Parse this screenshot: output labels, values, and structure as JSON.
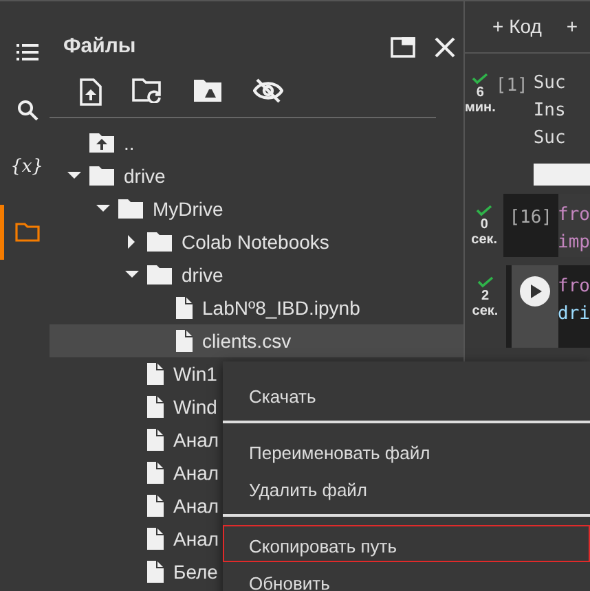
{
  "rail": [
    {
      "kind": "menu",
      "selected": false
    },
    {
      "kind": "search",
      "selected": false
    },
    {
      "kind": "variables",
      "label": "{x}",
      "selected": false
    },
    {
      "kind": "files",
      "selected": true
    }
  ],
  "panel": {
    "title": "Файлы",
    "toolbar": [
      {
        "kind": "upload"
      },
      {
        "kind": "folder-refresh"
      },
      {
        "kind": "drive"
      },
      {
        "kind": "hidden"
      }
    ]
  },
  "tree": [
    {
      "kind": "up",
      "name": ".."
    },
    {
      "kind": "folder",
      "name": "drive",
      "expanded": true,
      "children": [
        {
          "kind": "folder",
          "name": "MyDrive",
          "expanded": true,
          "children": [
            {
              "kind": "folder",
              "name": "Colab Notebooks",
              "expanded": false
            },
            {
              "kind": "folder",
              "name": "drive",
              "expanded": true,
              "children": [
                {
                  "kind": "file",
                  "name": "LabNº8_IBD.ipynb",
                  "selected": false
                },
                {
                  "kind": "file",
                  "name": "clients.csv",
                  "selected": true
                }
              ]
            },
            {
              "kind": "file",
              "name": "Win1",
              "selected": false
            },
            {
              "kind": "file",
              "name": "Wind",
              "selected": false
            },
            {
              "kind": "file",
              "name": "Анал",
              "selected": false
            },
            {
              "kind": "file",
              "name": "Анал",
              "selected": false
            },
            {
              "kind": "file",
              "name": "Анал",
              "selected": false
            },
            {
              "kind": "file",
              "name": "Анал",
              "selected": false
            },
            {
              "kind": "file",
              "name": "Беле",
              "selected": false
            }
          ]
        }
      ]
    }
  ],
  "notebook": {
    "toolbar": [
      "+ Код",
      "+"
    ],
    "cells": [
      {
        "kind": "output",
        "done": true,
        "time": "6",
        "unit": "мин.",
        "count": "[1]",
        "lines": [
          "Suc",
          "Ins",
          "Suc"
        ]
      },
      {
        "kind": "code",
        "done": true,
        "time": "0",
        "unit": "сек.",
        "count": "[16]",
        "lines": [
          "fro",
          "imp"
        ]
      },
      {
        "kind": "run",
        "done": true,
        "time": "2",
        "unit": "сек.",
        "lines": [
          "fro",
          "dri"
        ]
      }
    ]
  },
  "menu": {
    "groups": [
      [
        {
          "label": "Скачать",
          "selected": false
        }
      ],
      [
        {
          "label": "Переименовать файл",
          "selected": false
        },
        {
          "label": "Удалить файл",
          "selected": false
        }
      ],
      [
        {
          "label": "Скопировать путь",
          "selected": true
        },
        {
          "label": "Обновить",
          "selected": false
        }
      ]
    ]
  }
}
